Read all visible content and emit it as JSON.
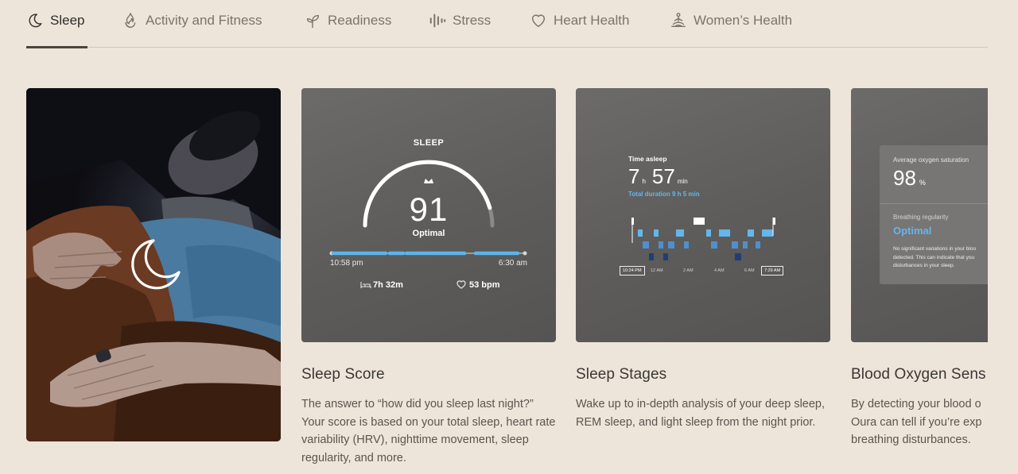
{
  "tabs": [
    {
      "label": "Sleep",
      "icon": "moon-icon",
      "active": true
    },
    {
      "label": "Activity and Fitness",
      "icon": "flame-icon",
      "active": false
    },
    {
      "label": "Readiness",
      "icon": "sprout-icon",
      "active": false
    },
    {
      "label": "Stress",
      "icon": "waveform-icon",
      "active": false
    },
    {
      "label": "Heart Health",
      "icon": "heart-icon",
      "active": false
    },
    {
      "label": "Women’s Health",
      "icon": "meditation-icon",
      "active": false
    }
  ],
  "cards": [
    {
      "title": "Sleep Score",
      "description": "The answer to “how did you sleep last night?” Your score is based on your total sleep, heart rate variability (HRV), nighttime movement, sleep regularity, and more."
    },
    {
      "title": "Sleep Stages",
      "description": "Wake up to in-depth analysis of your deep sleep, REM sleep, and light sleep from the night prior."
    },
    {
      "title": "Blood Oxygen Sens",
      "description": "By detecting your blood o Oura can tell if you’re exp breathing disturbances."
    }
  ],
  "sleep_score_panel": {
    "heading": "SLEEP",
    "score": "91",
    "score_label": "Optimal",
    "score_fraction": 0.91,
    "start_time": "10:58 pm",
    "end_time": "6:30 am",
    "duration": "7h 32m",
    "heart_rate": "53 bpm"
  },
  "sleep_stages_panel": {
    "label": "Time asleep",
    "hours": "7",
    "hours_unit": "h",
    "minutes": "57",
    "minutes_unit": "min",
    "total": "Total duration 9 h 5 min",
    "axis": [
      "10:24 PM",
      "12 AM",
      "2 AM",
      "4 AM",
      "6 AM",
      "7:29 AM"
    ]
  },
  "oxygen_panel": {
    "label": "Average oxygen saturation",
    "value": "98",
    "unit": "%",
    "regularity_label": "Breathing regularity",
    "regularity_value": "Optimal",
    "note": "No significant variations in your bloo detected. This can indicate that you disturbances in your sleep."
  },
  "colors": {
    "background": "#ede5da",
    "accent_blue": "#5db4ea",
    "deep_blue": "#1f3f74",
    "light_blue": "#64b6ec"
  }
}
